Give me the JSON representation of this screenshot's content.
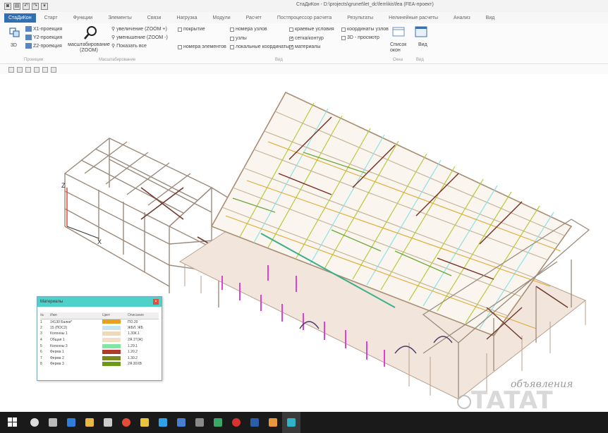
{
  "window": {
    "title": "СтаДиКон - D:\\projects\\grunet\\let_dc\\fem\\kis\\fea (FEA-проект)",
    "quick_access": [
      "◙",
      "▤",
      "↶",
      "↷",
      "▾"
    ]
  },
  "menu": {
    "app_tab": "СтаДиКон",
    "items": [
      "Старт",
      "Функции",
      "Элементы",
      "Связи",
      "Нагрузка",
      "Модули",
      "Расчет",
      "Постпроцессор расчета",
      "Результаты",
      "Нелинейные расчеты",
      "Анализ",
      "Вид"
    ]
  },
  "ribbon": {
    "projections": {
      "p1": "X1-проекция",
      "p2": "Y2-проекция",
      "p3": "Z2-проекция",
      "btn3d": "3D",
      "group": "Проекции"
    },
    "zoom": {
      "label": "масштабирование (ZOOM)",
      "zoom_in": "увеличение (ZOOM +)",
      "zoom_out": "уменьшение (ZOOM -)",
      "show_all": "Показать все",
      "group": "Масштабирование"
    },
    "display": {
      "col1": [
        "покрытие",
        "",
        "номера элементов"
      ],
      "col2": [
        "номера узлов",
        "узлы",
        "локальные координаты"
      ],
      "col3": [
        "краевые условия",
        "сетка/контур",
        "материалы"
      ],
      "col3_checked": [
        false,
        true,
        true
      ],
      "col4": [
        "координаты узлов",
        "3D - просмотр"
      ],
      "group": "Вид"
    },
    "extra": {
      "list": "Список окон",
      "view": "Вид",
      "group_list": "Окна",
      "group_view": "Вид"
    }
  },
  "axes": {
    "x": "X",
    "z": "Z"
  },
  "materials": {
    "title": "Материалы",
    "close": "×",
    "columns": [
      "№",
      "Имя",
      "Цвет",
      "Описание"
    ],
    "rows": [
      {
        "n": "1",
        "name": "14130 Балки*",
        "color": "#e6a11f",
        "desc": "ПО.20"
      },
      {
        "n": "2",
        "name": "15 (ПОС2)",
        "color": "#c8e6f0",
        "desc": "ЖБЛ. ЖБ"
      },
      {
        "n": "3",
        "name": "Колонны 1",
        "color": "#eed9b8",
        "desc": "1.30К.1"
      },
      {
        "n": "4",
        "name": "Общая 1",
        "color": "#f3dfc4",
        "desc": "2Я.1Т(Ж)"
      },
      {
        "n": "5",
        "name": "Колонны 3",
        "color": "#7fe6a3",
        "desc": "1.29.1"
      },
      {
        "n": "6",
        "name": "Ферма 1",
        "color": "#b23a2c",
        "desc": "1.20.2"
      },
      {
        "n": "7",
        "name": "Ферма 2",
        "color": "#7a8a1c",
        "desc": "1.30.2"
      },
      {
        "n": "8",
        "name": "Ферма 3",
        "color": "#6b9a16",
        "desc": "2Я.30ХВ"
      }
    ]
  },
  "watermark": {
    "small": "объявления",
    "big": "TATAT"
  },
  "taskbar": {
    "icons": [
      {
        "name": "search",
        "color": "#dddddd"
      },
      {
        "name": "task-view",
        "color": "#bbbbbb"
      },
      {
        "name": "edge",
        "color": "#2f7fd8"
      },
      {
        "name": "explorer",
        "color": "#e9b844"
      },
      {
        "name": "store",
        "color": "#cccccc"
      },
      {
        "name": "chrome",
        "color": "#e14c3b"
      },
      {
        "name": "app-yellow",
        "color": "#e9c43c"
      },
      {
        "name": "skype",
        "color": "#2ea4e8"
      },
      {
        "name": "app-blue",
        "color": "#4a7fd0"
      },
      {
        "name": "app-gray",
        "color": "#8a8a8a"
      },
      {
        "name": "app-green",
        "color": "#3aa866"
      },
      {
        "name": "opera",
        "color": "#d8332f"
      },
      {
        "name": "app-word",
        "color": "#2b5ea8"
      },
      {
        "name": "app-paint",
        "color": "#e6983a"
      },
      {
        "name": "stadikon",
        "color": "#2fb3c8"
      }
    ]
  }
}
